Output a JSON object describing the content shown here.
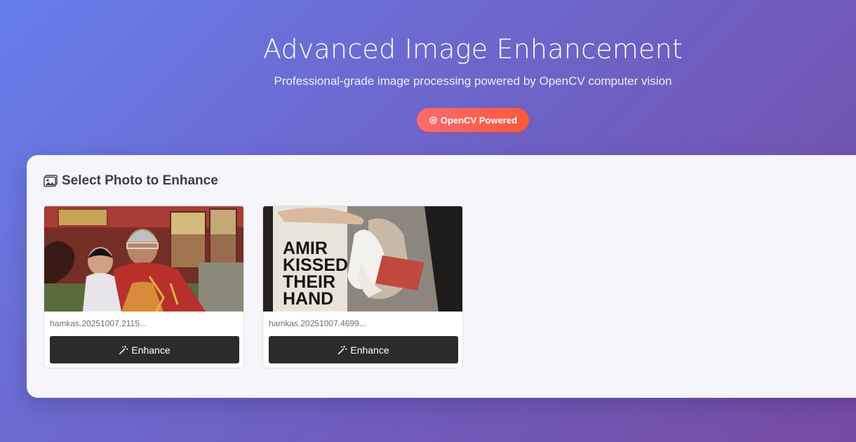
{
  "header": {
    "title": "Advanced Image Enhancement",
    "subtitle": "Professional-grade image processing powered by OpenCV computer vision",
    "badge": {
      "label": "OpenCV Powered",
      "icon": "chip-icon"
    }
  },
  "panel": {
    "title": "Select Photo to Enhance",
    "title_icon": "image-icon"
  },
  "photos": [
    {
      "filename": "hamkas.20251007.2115...",
      "button_label": "Enhance",
      "button_icon": "magic-wand-icon"
    },
    {
      "filename": "hamkas.20251007.4699...",
      "button_label": "Enhance",
      "button_icon": "magic-wand-icon"
    }
  ],
  "thumbnails": {
    "photo2_text": [
      "AMIR",
      "KISSED",
      "THEIR",
      "HAND"
    ]
  },
  "colors": {
    "gradient_start": "#667eea",
    "gradient_end": "#764ba2",
    "badge_start": "#fb6a6f",
    "badge_end": "#f85a3a",
    "button_bg": "#2b2b2b",
    "panel_bg": "#f5f5fa"
  }
}
